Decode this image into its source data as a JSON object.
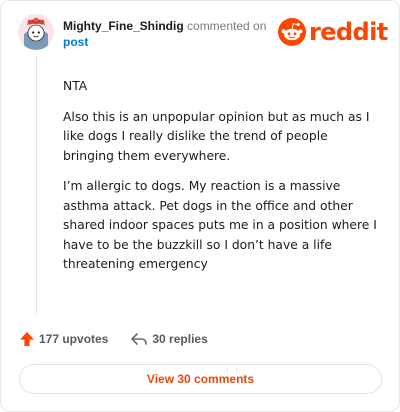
{
  "comment": {
    "username": "Mighty_Fine_Shindig",
    "commented_on_text": "commented on",
    "post_link_label": "post",
    "paragraphs": [
      "NTA",
      "Also this is an unpopular opinion but as much as I like dogs I really dislike the trend of people bringing them everywhere.",
      "I’m allergic to dogs. My reaction is a massive asthma attack. Pet dogs in the office and other shared indoor spaces puts me in a position where I have to be the buzzkill so I don’t have a life threatening emergency"
    ]
  },
  "brand": {
    "name": "reddit",
    "color": "#ff4500"
  },
  "actions": {
    "upvotes_label": "177 upvotes",
    "replies_label": "30 replies"
  },
  "footer": {
    "view_comments_label": "View 30 comments"
  },
  "icons": {
    "upvote": "upvote-arrow-icon",
    "reply": "reply-arrow-icon",
    "logo": "reddit-snoo-icon",
    "avatar": "snoo-avatar-icon"
  },
  "colors": {
    "upvote": "#ff4500",
    "link": "#0079d3",
    "view_comments": "#e8490a"
  }
}
